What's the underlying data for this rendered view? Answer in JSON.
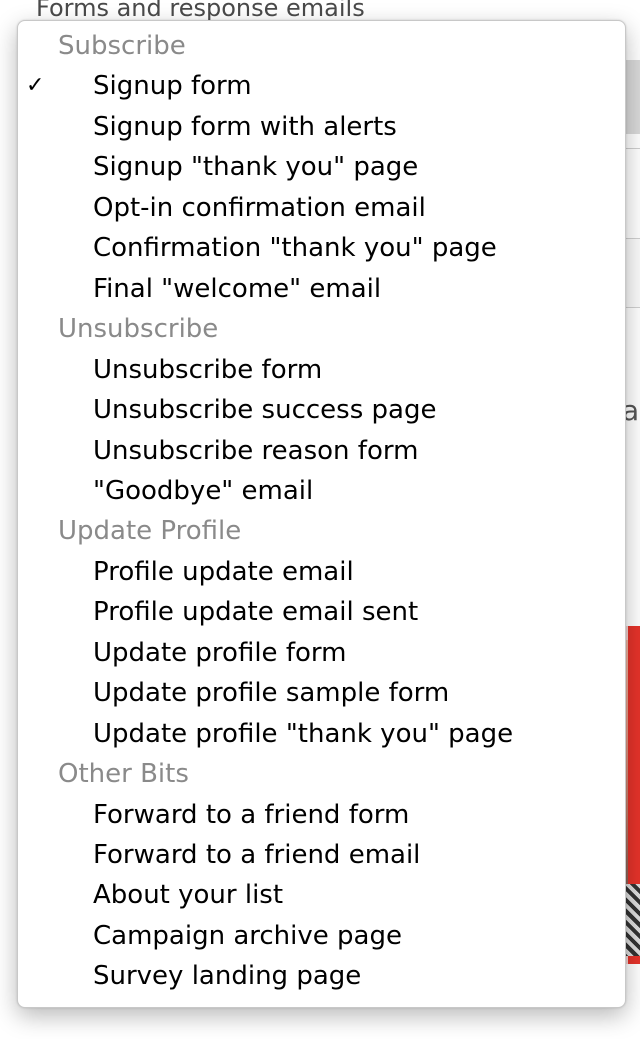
{
  "background": {
    "heading": "Forms and response emails",
    "side_letter": "a"
  },
  "menu": {
    "checkmark": "✓",
    "selected": "Signup form",
    "groups": [
      {
        "header": "Subscribe",
        "items": [
          "Signup form",
          "Signup form with alerts",
          "Signup \"thank you\" page",
          "Opt-in confirmation email",
          "Confirmation \"thank you\" page",
          "Final \"welcome\" email"
        ]
      },
      {
        "header": "Unsubscribe",
        "items": [
          "Unsubscribe form",
          "Unsubscribe success page",
          "Unsubscribe reason form",
          "\"Goodbye\" email"
        ]
      },
      {
        "header": "Update Profile",
        "items": [
          "Profile update email",
          "Profile update email sent",
          "Update profile form",
          "Update profile sample form",
          "Update profile \"thank you\" page"
        ]
      },
      {
        "header": "Other Bits",
        "items": [
          "Forward to a friend form",
          "Forward to a friend email",
          "About your list",
          "Campaign archive page",
          "Survey landing page"
        ]
      }
    ]
  }
}
